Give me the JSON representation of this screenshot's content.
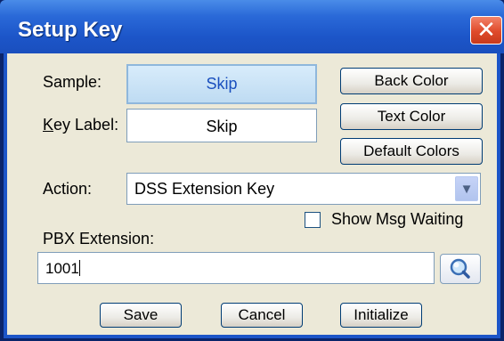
{
  "window": {
    "title": "Setup Key",
    "close_glyph": "✕"
  },
  "form": {
    "sample_label": "Sample:",
    "sample_value": "Skip",
    "key_label_prefix": "K",
    "key_label_rest": "ey Label:",
    "key_label_value": "Skip",
    "action_label": "Action:",
    "action_value": "DSS Extension Key",
    "action_arrow": "▼",
    "show_msg_waiting_label": "Show Msg Waiting",
    "show_msg_waiting_checked": false,
    "pbx_label": "PBX Extension:",
    "pbx_value": "1001"
  },
  "buttons": {
    "back_color": "Back Color",
    "text_color": "Text Color",
    "default_colors": "Default Colors",
    "save": "Save",
    "cancel": "Cancel",
    "initialize": "Initialize"
  },
  "icons": {
    "close": "close-icon",
    "dropdown": "chevron-down-icon",
    "search": "magnifier-icon"
  },
  "colors": {
    "titlebar": "#1c55c8",
    "dialog_bg": "#ece9d8",
    "sample_text": "#1a4fbe",
    "close_button": "#df4a2b"
  }
}
